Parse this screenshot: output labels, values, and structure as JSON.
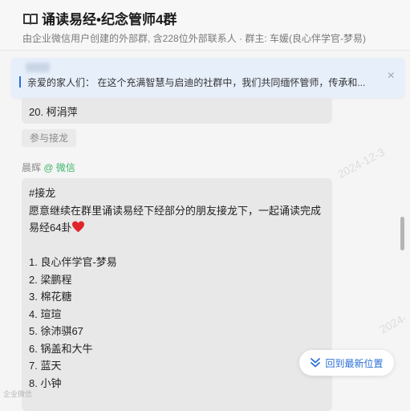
{
  "header": {
    "title": "诵读易经•纪念管师4群",
    "subtitle": "由企业微信用户创建的外部群, 含228位外部联系人 · 群主: 车媛(良心伴学官-梦易)"
  },
  "notice": {
    "text": "亲爱的家人们：  在这个充满智慧与启迪的社群中，我们共同缅怀管师，传承和...",
    "close_label": "×"
  },
  "previous_message": {
    "last_line": "20. 柯涓萍",
    "join_button": "参与接龙"
  },
  "message": {
    "sender": "晨辉",
    "source": "@ 微信",
    "lines": [
      "#接龙",
      "愿意继续在群里诵读易经下经部分的朋友接龙下，一起诵读完成",
      "易经64卦",
      "",
      "1. 良心伴学官-梦易",
      "2. 梁鹏程",
      "3. 棉花糖",
      "4. 瑄瑄",
      "5. 徐沛骐67",
      "6. 锅盖和大牛",
      "7. 蓝天",
      "8. 小钟"
    ]
  },
  "watermarks": [
    "2024-12-3",
    "2024-"
  ],
  "latest_button": "回到最新位置",
  "corner_text": "企业微信"
}
